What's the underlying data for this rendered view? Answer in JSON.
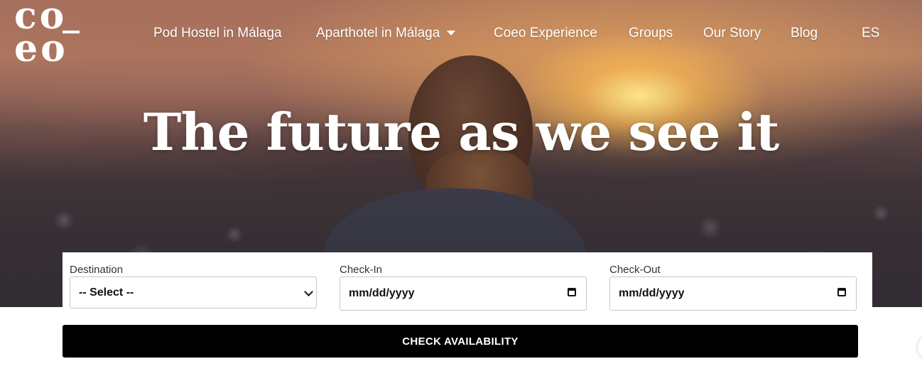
{
  "logo": {
    "top_left": "c",
    "top_right": "o",
    "bottom_left": "e",
    "bottom_right": "o"
  },
  "nav": {
    "items": [
      {
        "label": "Pod Hostel in Málaga"
      },
      {
        "label": "Aparthotel in Málaga",
        "has_dropdown": true
      },
      {
        "label": "Coeo Experience"
      },
      {
        "label": "Groups"
      },
      {
        "label": "Our Story"
      },
      {
        "label": "Blog"
      }
    ],
    "language": "ES"
  },
  "hero": {
    "title": "The future as we see it"
  },
  "booking": {
    "destination": {
      "label": "Destination",
      "value": "-- Select --"
    },
    "checkin": {
      "label": "Check-In",
      "value": "mm/dd/yyyy"
    },
    "checkout": {
      "label": "Check-Out",
      "value": "mm/dd/yyyy"
    },
    "submit_label": "CHECK AVAILABILITY"
  },
  "icons": {
    "calendar": "calendar-icon",
    "dropdown": "chevron-down-icon",
    "nav_caret": "caret-down-icon"
  },
  "colors": {
    "button_bg": "#000000",
    "text_on_hero": "#ffffff"
  }
}
